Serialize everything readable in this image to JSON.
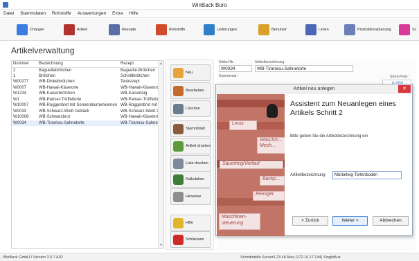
{
  "window": {
    "title": "WinBack Büro"
  },
  "menu": [
    "Datei",
    "Stammdaten",
    "Rohstoffe",
    "Auswertungen",
    "Extra",
    "Hilfe"
  ],
  "toolbar": {
    "items": [
      {
        "label": "Chargen",
        "icon": "chargen-icon",
        "color": "#3b7de0"
      },
      {
        "label": "Artikel",
        "icon": "artikel-icon",
        "color": "#b2332d"
      },
      {
        "label": "Rezepte",
        "icon": "rezepte-icon",
        "color": "#5b6fa6"
      },
      {
        "label": "Rohstoffe",
        "icon": "rohstoffe-icon",
        "color": "#d04b2b"
      },
      {
        "label": "Lieferungen",
        "icon": "lieferungen-icon",
        "color": "#2f7fc9"
      },
      {
        "label": "Benutzer",
        "icon": "benutzer-icon",
        "color": "#d9a12a"
      },
      {
        "label": "Linien",
        "icon": "linien-icon",
        "color": "#4a66b5"
      },
      {
        "label": "Produktionsplanung",
        "icon": "produktionsplanung-icon",
        "color": "#6d7fb8"
      },
      {
        "label": "Sc",
        "icon": "extra-icon",
        "color": "#d63b9a"
      }
    ]
  },
  "page": {
    "title": "Artikelverwaltung"
  },
  "table": {
    "columns": [
      "Nummer",
      "Bezeichnung",
      "Rezept"
    ],
    "rows": [
      [
        "2",
        "Baguettebrötchen",
        "Baguette-Brötchen"
      ],
      [
        "1",
        "Brötchen",
        "Schnittbrötchen"
      ],
      [
        "W00277",
        "WB-Dinkelbrötchen",
        "Testrezept"
      ],
      [
        "W0007",
        "WB-Hawaii-Käsetorte",
        "WB-Hawaii-Käsetorte"
      ],
      [
        "W1234",
        "WB-Kaiserbrötchen",
        "WB-Kaiserteig"
      ],
      [
        "W1",
        "WB-Pariser-Trüffeltorte",
        "WB-Pariser-Trüffeltorte"
      ],
      [
        "W10007",
        "WB-Roggenbrot mit Sonnenblumenkernen",
        "WB-Roggenbrot mit Sonnenblumenkernen"
      ],
      [
        "W0033",
        "WB-Schwarz-Weiß Gebäck",
        "WB-Schwarz-Weiß Gebäck"
      ],
      [
        "W10008",
        "WB-Schwarzbrot",
        "WB-Hawaii-Käsetorte"
      ],
      [
        "W0034",
        "WB-Tiramisu-Sahnetorte",
        "WB-Tiramisu-Sahnetorte"
      ]
    ]
  },
  "actions": [
    {
      "label": "Neu",
      "icon": "new-article-icon",
      "color": "#e8a33a"
    },
    {
      "label": "Bearbeiten",
      "icon": "edit-icon",
      "color": "#c46a2b"
    },
    {
      "label": "Löschen",
      "icon": "delete-icon",
      "color": "#6b7c8f"
    },
    {
      "label": "Stammblatt",
      "icon": "stammblatt-icon",
      "color": "#8a5a3b"
    },
    {
      "label": "Artikel drucken",
      "icon": "print-article-icon",
      "color": "#5c9a3a"
    },
    {
      "label": "Liste drucken",
      "icon": "print-list-icon",
      "color": "#7d8a9a"
    },
    {
      "label": "Kalkulation",
      "icon": "calculator-icon",
      "color": "#3f7d3a"
    },
    {
      "label": "Hinweise",
      "icon": "notes-icon",
      "color": "#8e8e8e"
    },
    {
      "label": "Hilfe",
      "icon": "help-icon",
      "color": "#e0b62a"
    },
    {
      "label": "Schliessen",
      "icon": "close-icon",
      "color": "#cf2a2a"
    }
  ],
  "detail": {
    "artikel_nr_label": "Artikel-Nr.",
    "artikel_nr": "W0034",
    "bezeichnung_label": "Artikelbezeichnung",
    "bezeichnung": "WB-Tiramisu-Sahnetorte",
    "kommentar_label": "Kommentar:",
    "preis_label": "Stück-Preis:",
    "preis": "0.000"
  },
  "dialog": {
    "title": "Artikel neu anlegen",
    "heading": "Assistent zum Neuanlegen eines Artikels Schritt 2",
    "prompt": "Bitte geben Sie die Artikelbezeichnung ein",
    "field_label": "Artikelbezeichnung",
    "field_value": "Mürbeteig-Tortenboden",
    "back_label": "< Zurück",
    "next_label": "Weiter >",
    "cancel_label": "Abbrechen",
    "image_cards": [
      "Linux",
      "Waschm... Mech...",
      "Sauerteig/Vorlauf",
      "Backp...",
      "Reiniger",
      "Maschinen-steuerung"
    ]
  },
  "status": {
    "left": "WinBack GmbH / Version 3.0.7 A02",
    "right": "Schnittstelle Server3.23.48-Max (172.16.17.144) SingleBus"
  }
}
